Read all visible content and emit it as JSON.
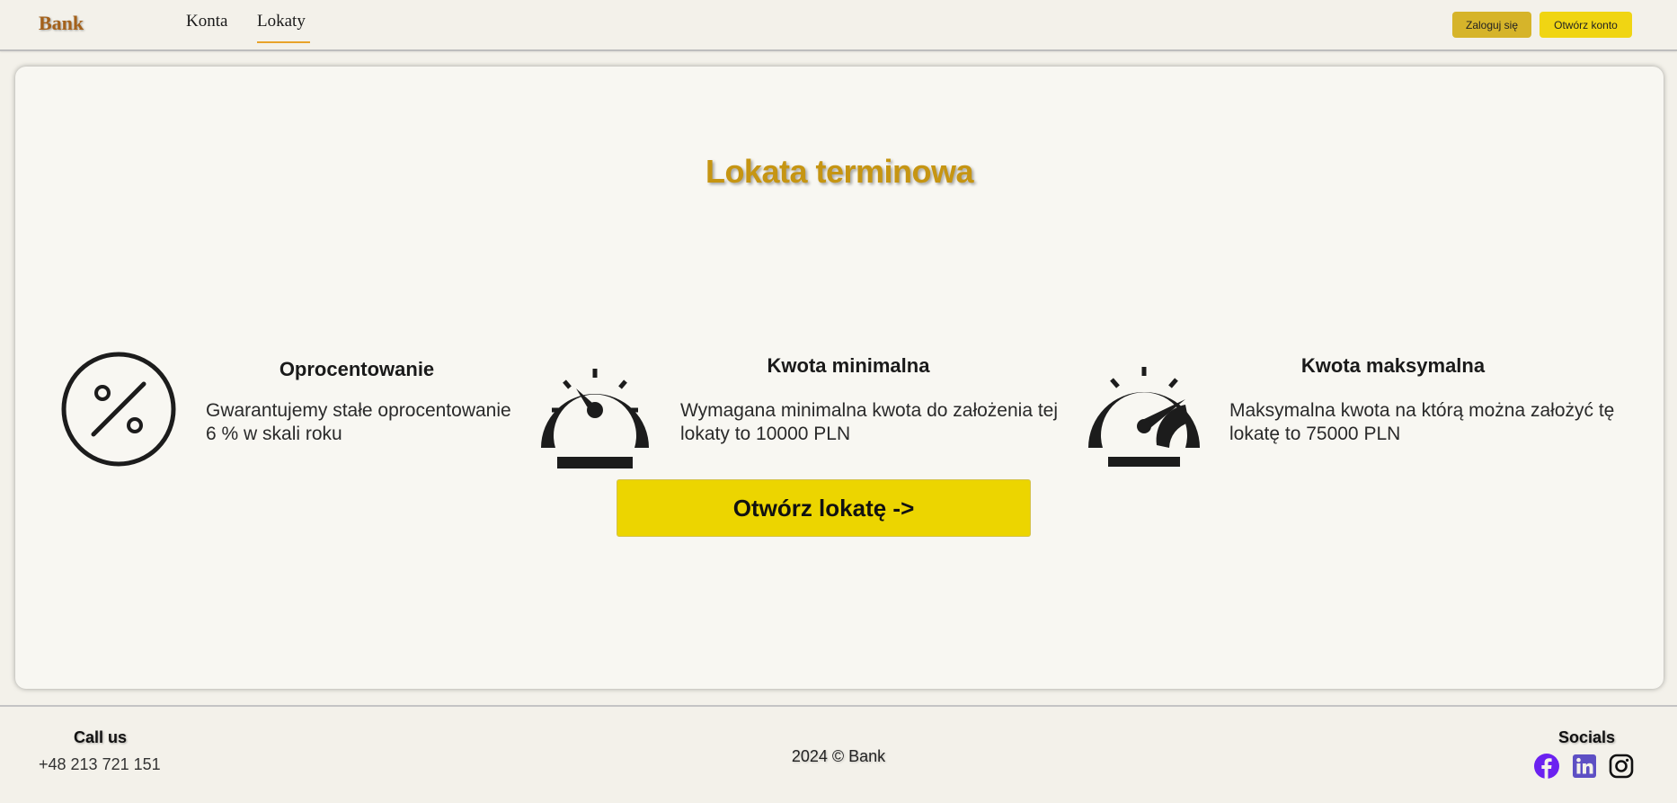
{
  "header": {
    "brand": "Bank",
    "nav": [
      {
        "label": "Konta",
        "active": false
      },
      {
        "label": "Lokaty",
        "active": true
      }
    ],
    "login_label": "Zaloguj się",
    "open_account_label": "Otwórz konto"
  },
  "main": {
    "title": "Lokata terminowa",
    "features": [
      {
        "icon": "percent-icon",
        "title": "Oprocentowanie",
        "text": "Gwarantujemy stałe oprocentowanie 6 % w skali roku"
      },
      {
        "icon": "speedometer-low-icon",
        "title": "Kwota minimalna",
        "text": "Wymagana minimalna kwota do założenia tej lokaty to 10000 PLN"
      },
      {
        "icon": "speedometer-high-icon",
        "title": "Kwota maksymalna",
        "text": "Maksymalna kwota na którą można założyć tę lokatę to 75000 PLN"
      }
    ],
    "cta_label": "Otwórz lokatę ->"
  },
  "footer": {
    "call_title": "Call us",
    "phone": "+48 213 721 151",
    "copyright": "2024 © Bank",
    "socials_title": "Socials",
    "socials": [
      {
        "icon": "facebook-icon",
        "color": "#6b21f0"
      },
      {
        "icon": "linkedin-icon",
        "color": "#5d4fc4"
      },
      {
        "icon": "instagram-icon",
        "color": "#111111"
      }
    ]
  },
  "colors": {
    "brand": "#a4611a",
    "title": "#c69512",
    "accent_yellow": "#ecd500",
    "login_button": "#d6b42a",
    "nav_underline": "#e8a32a"
  }
}
